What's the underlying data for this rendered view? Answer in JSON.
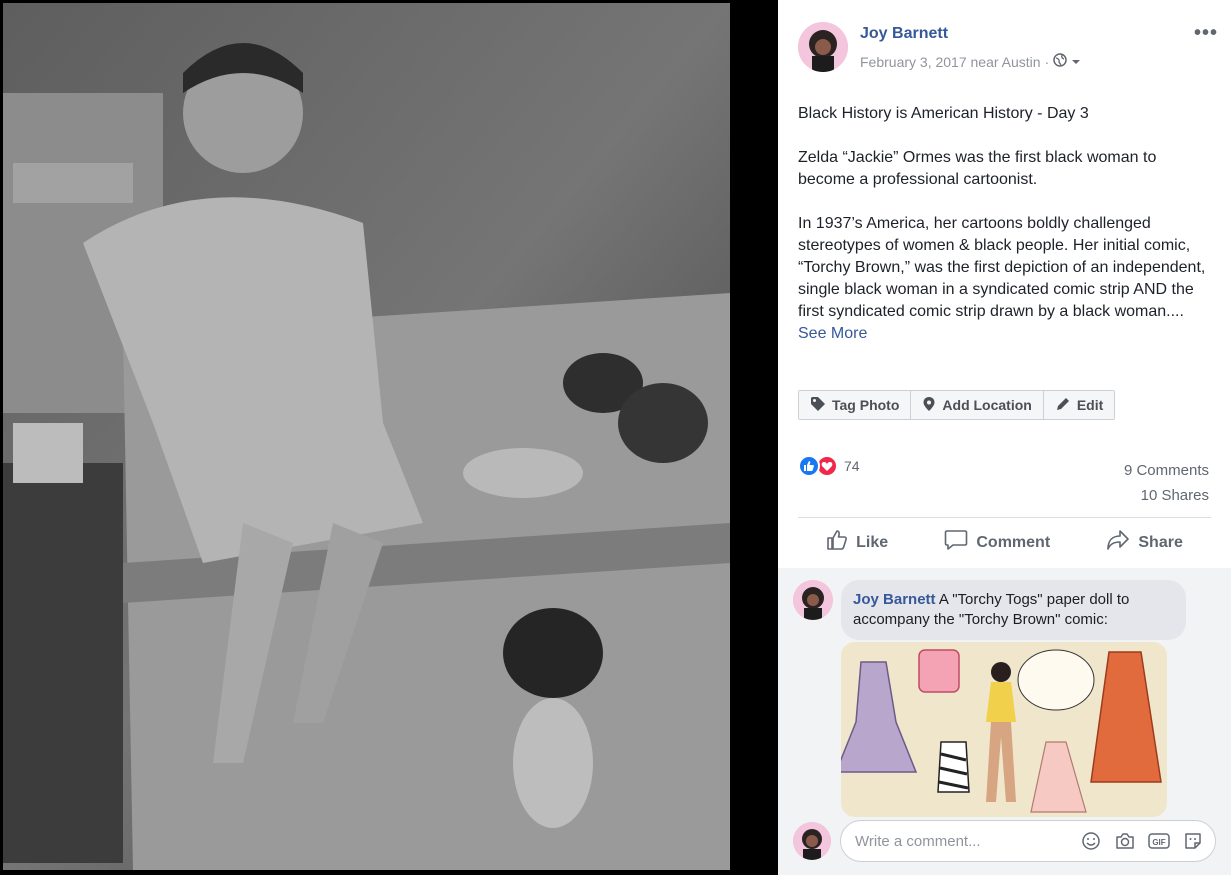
{
  "post": {
    "author": "Joy Barnett",
    "date": "February 3, 2017 near Austin",
    "separator": "·",
    "more_label": "•••",
    "paragraphs": [
      "Black History is American History - Day 3",
      "Zelda “Jackie” Ormes was the first black woman to become a professional cartoonist.",
      "In 1937’s America, her cartoons boldly challenged stereotypes of women & black people. Her initial comic, “Torchy Brown,” was the first depiction of an independent, single black woman in a syndicated comic strip AND the first syndicated comic strip drawn by a black woman...."
    ],
    "see_more": "See More"
  },
  "photo_actions": {
    "tag": "Tag Photo",
    "location": "Add Location",
    "edit": "Edit"
  },
  "reactions": {
    "count": "74",
    "comments": "9 Comments",
    "shares": "10 Shares"
  },
  "action_row": {
    "like": "Like",
    "comment": "Comment",
    "share": "Share"
  },
  "comment": {
    "author": "Joy Barnett",
    "text": "A \"Torchy Togs\" paper doll to accompany the \"Torchy Brown\" comic:"
  },
  "write": {
    "placeholder": "Write a comment..."
  },
  "colors": {
    "link": "#365899",
    "like_blue": "#1877f2",
    "love_red": "#f0284a",
    "muted": "#606770"
  },
  "icons": [
    "globe-icon",
    "tag-icon",
    "location-pin-icon",
    "pencil-icon",
    "thumbs-up-icon",
    "speech-bubble-icon",
    "share-arrow-icon",
    "heart-icon",
    "emoji-icon",
    "camera-icon",
    "gif-icon",
    "sticker-icon"
  ]
}
